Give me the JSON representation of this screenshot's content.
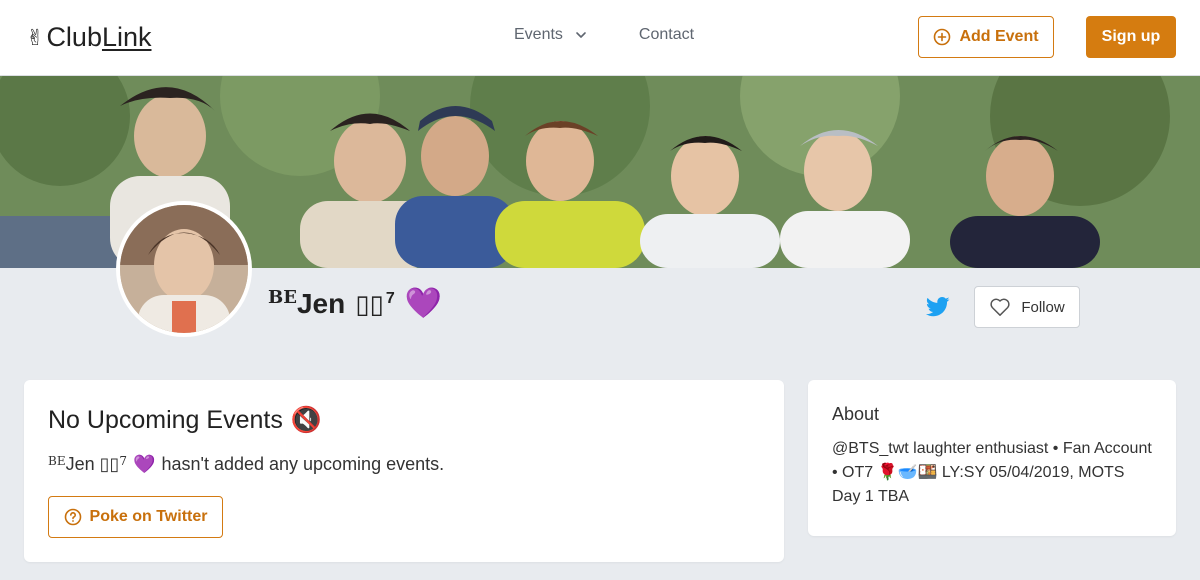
{
  "header": {
    "logo_hand": "✌",
    "logo_text_club": "Club",
    "logo_text_link": "Link",
    "nav_events": "Events",
    "nav_contact": "Contact",
    "add_event_label": "Add Event",
    "signup_label": "Sign up"
  },
  "colors": {
    "accent": "#d57c10",
    "twitter": "#1da1f2",
    "page_bg": "#e8ebef"
  },
  "profile": {
    "name_sup": "BE",
    "name_main": "Jen",
    "name_boxes": "▯▯",
    "name_sup7": "7",
    "name_heart": "💜",
    "follow_label": "Follow"
  },
  "events": {
    "title": "No Upcoming Events",
    "title_icon": "🔇",
    "desc_sup": "BE",
    "desc_name": "Jen ▯▯",
    "desc_sup7": "7",
    "desc_heart": "💜",
    "desc_text": "hasn't added any upcoming events.",
    "poke_label": "Poke on Twitter"
  },
  "about": {
    "title": "About",
    "text": "@BTS_twt laughter enthusiast • Fan Account • OT7 🌹🥣🍱 LY:SY 05/04/2019, MOTS Day 1 TBA"
  }
}
